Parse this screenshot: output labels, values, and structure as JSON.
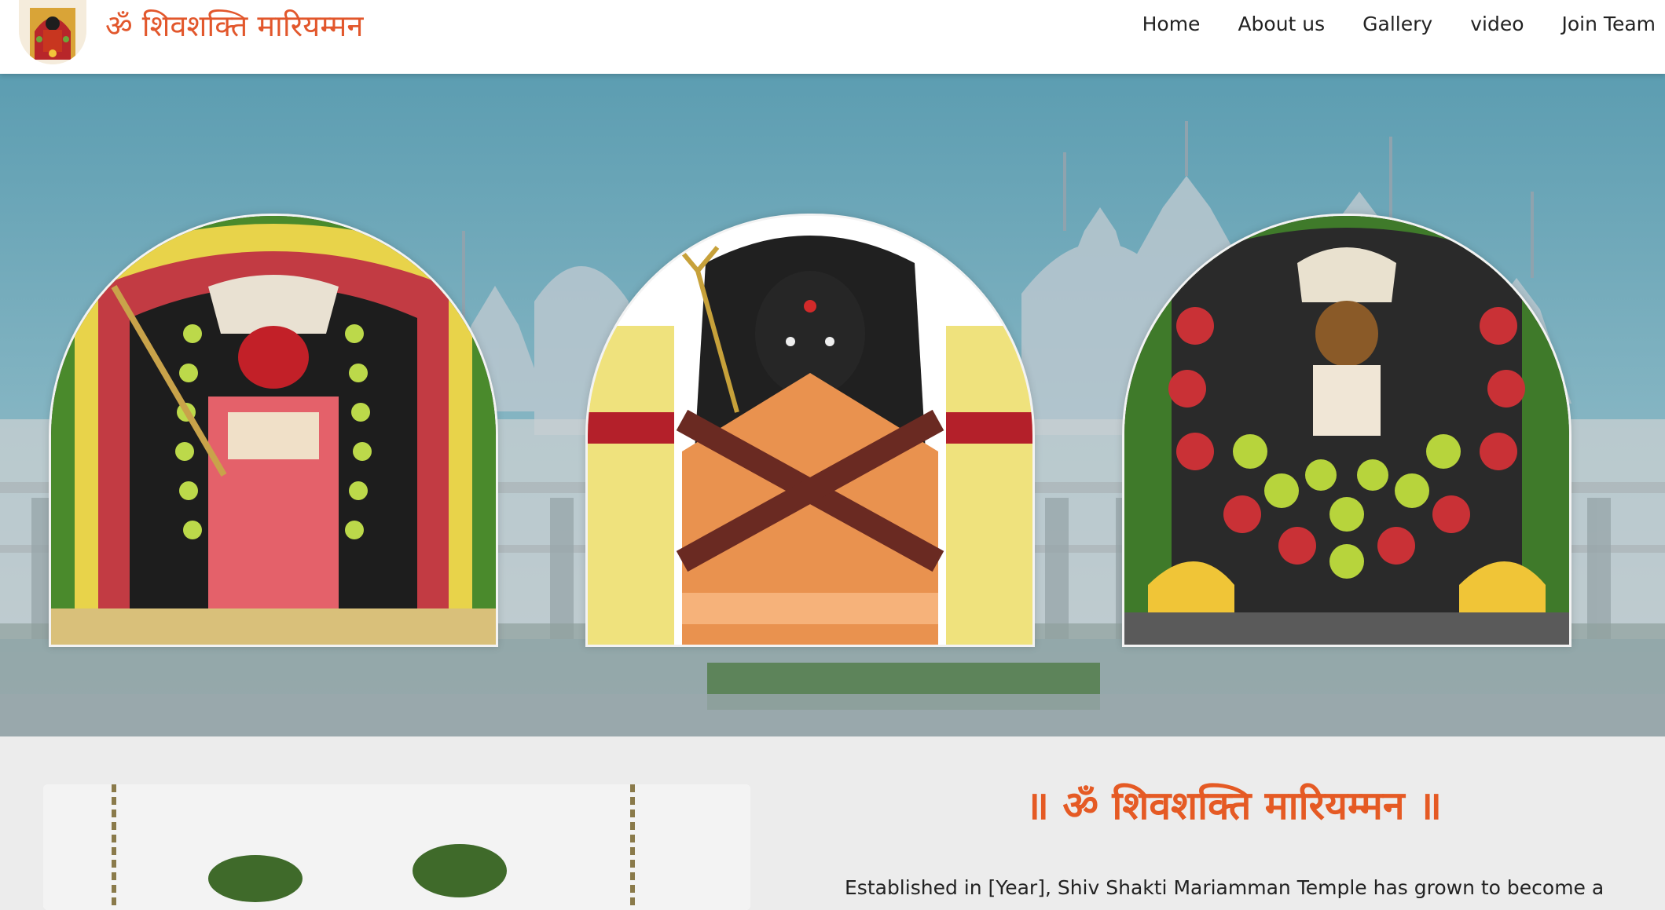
{
  "header": {
    "brand_title": "ॐ शिवशक्ति मारियम्मन",
    "logo_icon": "deity-logo-icon",
    "nav": [
      {
        "label": "Home"
      },
      {
        "label": "About us"
      },
      {
        "label": "Gallery"
      },
      {
        "label": "video"
      },
      {
        "label": "Join Team"
      }
    ]
  },
  "hero": {
    "background": "temple-backdrop",
    "images": [
      {
        "name": "deity-red-attire-image"
      },
      {
        "name": "deity-orange-saree-image"
      },
      {
        "name": "deity-fruit-offering-image"
      }
    ]
  },
  "about": {
    "title": "॥ ॐ शिवशक्ति मारियम्मन ॥",
    "intro": "Established in [Year], Shiv Shakti Mariamman Temple has grown to become a"
  },
  "colors": {
    "brand_accent": "#e2572c",
    "title_accent": "#e55a24",
    "section_bg": "#ececec",
    "header_bg": "#ffffff"
  }
}
